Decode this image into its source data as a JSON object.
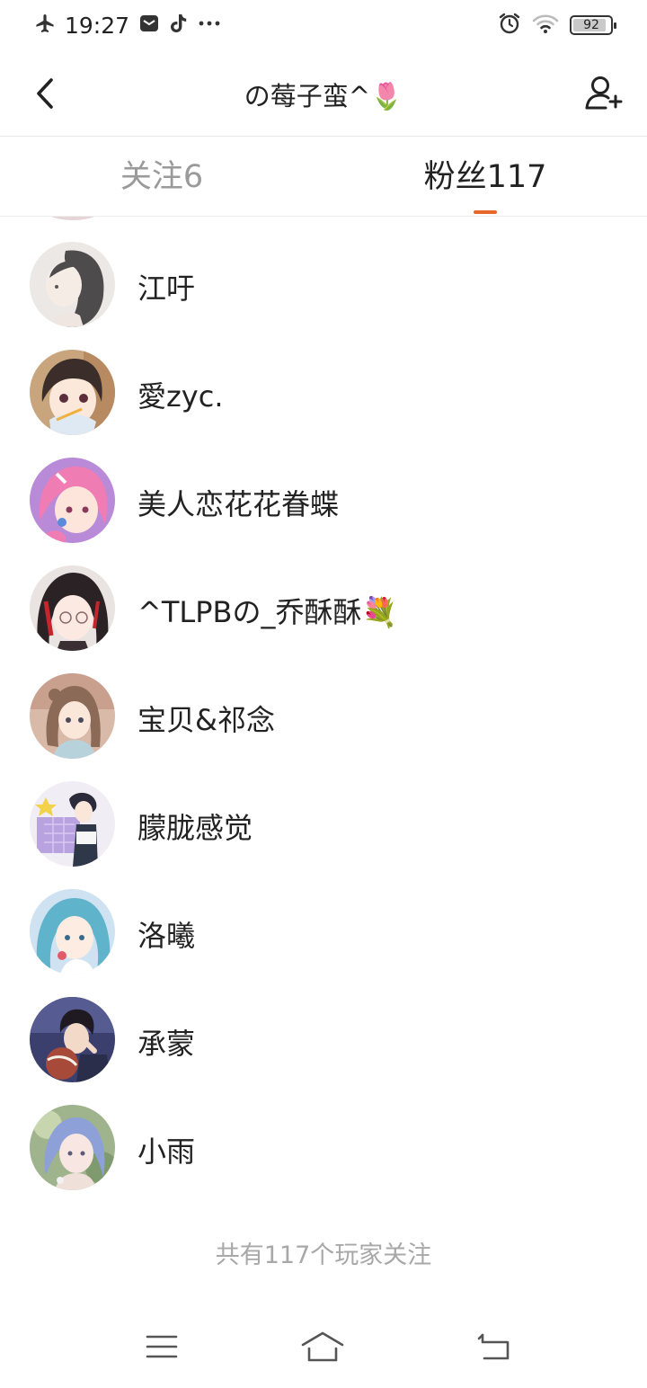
{
  "status_bar": {
    "time": "19:27",
    "battery": "92",
    "battery_level": 0.92,
    "left_icons": [
      "airplane-mode-icon",
      "message-app-icon",
      "tiktok-icon",
      "more-notifications-icon"
    ],
    "right_icons": [
      "alarm-icon",
      "wifi-icon",
      "battery-icon"
    ]
  },
  "header": {
    "title": "の莓子蛮^🌷",
    "back_icon": "chevron-left-icon",
    "add_user_icon": "add-user-icon"
  },
  "tabs": [
    {
      "label": "关注6",
      "active": false
    },
    {
      "label": "粉丝117",
      "active": true
    }
  ],
  "accent_color": "#e8662a",
  "fans": [
    {
      "name": "江吁"
    },
    {
      "name": "愛zyc."
    },
    {
      "name": "美人恋花花眷蝶"
    },
    {
      "name": "^TLPBの_乔酥酥💐"
    },
    {
      "name": "宝贝&祁念"
    },
    {
      "name": "朦胧感觉"
    },
    {
      "name": "洛曦"
    },
    {
      "name": "承蒙"
    },
    {
      "name": "小雨"
    }
  ],
  "footer": {
    "total_text": "共有117个玩家关注"
  },
  "system_nav": {
    "icons": [
      "menu-icon",
      "home-icon",
      "back-icon"
    ]
  }
}
